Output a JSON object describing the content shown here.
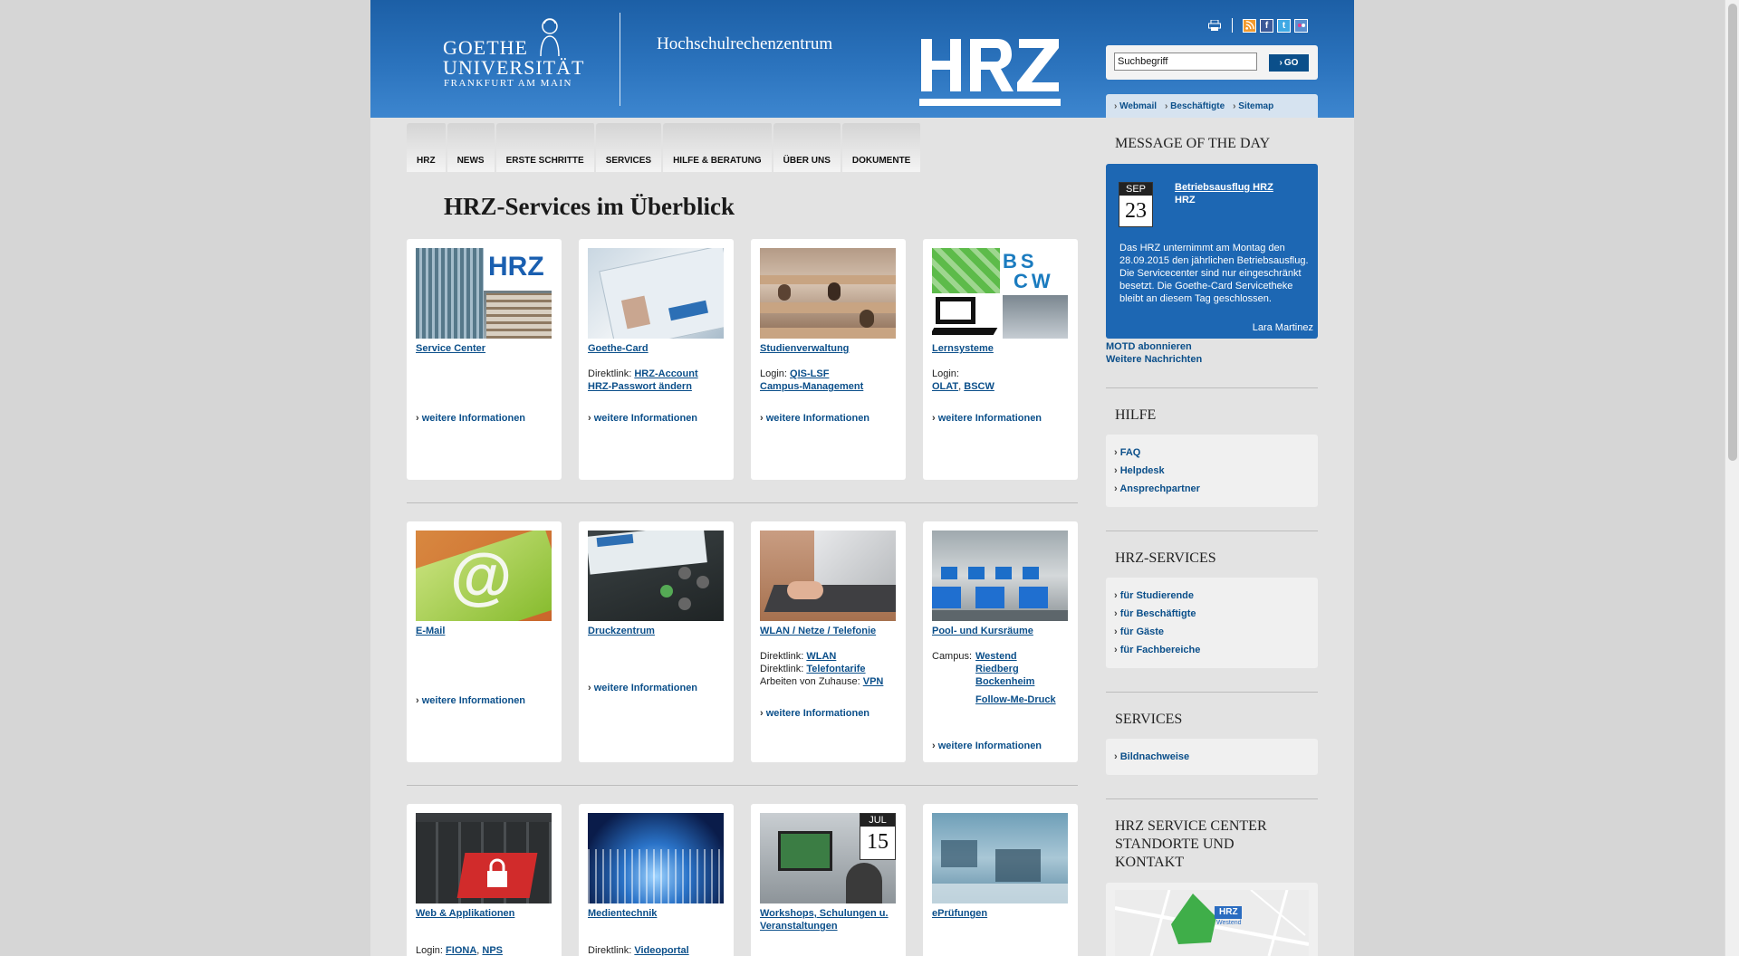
{
  "header": {
    "logo": {
      "line1": "GOETHE",
      "line2": "UNIVERSITÄT",
      "line3": "FRANKFURT AM MAIN"
    },
    "unit_title": "Hochschulrechenzentrum",
    "hrz_logo": "HRZ",
    "icons": [
      "print-icon",
      "rss-icon",
      "facebook-icon",
      "twitter-icon",
      "flickr-icon"
    ],
    "search": {
      "value": "Suchbegriff",
      "go_label": "GO"
    },
    "quicklinks": [
      "Webmail",
      "Beschäftigte",
      "Sitemap"
    ]
  },
  "nav": [
    "HRZ",
    "NEWS",
    "ERSTE SCHRITTE",
    "SERVICES",
    "HILFE & BERATUNG",
    "ÜBER UNS",
    "DOKUMENTE"
  ],
  "page_title": "HRZ-Services im Überblick",
  "cards": {
    "service_center": {
      "title": "Service Center",
      "more": "weitere Informationen",
      "img_text": "HRZ"
    },
    "goethe_card": {
      "title": "Goethe-Card",
      "prefix": "Direktlink:",
      "link1": "HRZ-Account",
      "link2": "HRZ-Passwort ändern",
      "more": "weitere Informationen"
    },
    "studienverwaltung": {
      "title": "Studienverwaltung",
      "prefix": "Login:",
      "link1": "QIS-LSF",
      "link2": "Campus-Management",
      "more": "weitere Informationen"
    },
    "lernsysteme": {
      "title": "Lernsysteme",
      "prefix": "Login:",
      "link1": "OLAT",
      "sep": ",",
      "link2": "BSCW",
      "more": "weitere Informationen"
    },
    "email": {
      "title": "E-Mail",
      "more": "weitere Informationen"
    },
    "druckzentrum": {
      "title": "Druckzentrum",
      "more": "weitere Informationen"
    },
    "wlan": {
      "title": "WLAN / Netze / Telefonie",
      "l1": "Direktlink:",
      "a1": "WLAN",
      "l2": "Direktlink:",
      "a2": "Telefontarife",
      "l3": "Arbeiten von Zuhause:",
      "a3": "VPN",
      "more": "weitere Informationen"
    },
    "pool": {
      "title": "Pool- und Kursräume",
      "prefix": "Campus:",
      "links": [
        "Westend",
        "Riedberg",
        "Bockenheim"
      ],
      "extra": "Follow-Me-Druck",
      "more": "weitere Informationen"
    },
    "web": {
      "title": "Web & Applikationen",
      "prefix": "Login:",
      "link1": "FIONA",
      "link2": "NPS"
    },
    "medientechnik": {
      "title": "Medientechnik",
      "prefix": "Direktlink:",
      "link1": "Videoportal"
    },
    "workshops": {
      "title": "Workshops, Schulungen u. Veranstaltungen",
      "cal_month": "JUL",
      "cal_day": "15"
    },
    "epruefungen": {
      "title": "ePrüfungen"
    }
  },
  "sidebar": {
    "motd_heading": "MESSAGE OF THE DAY",
    "motd": {
      "month": "SEP",
      "day": "23",
      "title": "Betriebsausflug HRZ",
      "subtitle": "HRZ",
      "body": "Das HRZ unternimmt am Montag den 28.09.2015 den jährlichen Betriebsausflug. Die Servicecenter sind nur eingeschränkt besetzt. Die Goethe-Card Servicetheke bleibt an diesem Tag geschlossen.",
      "author": "Lara Martinez"
    },
    "motd_links": [
      "MOTD abonnieren",
      "Weitere Nachrichten"
    ],
    "hilfe": {
      "heading": "HILFE",
      "items": [
        "FAQ",
        "Helpdesk",
        "Ansprechpartner"
      ]
    },
    "hrz_services": {
      "heading": "HRZ-SERVICES",
      "items": [
        "für Studierende",
        "für Beschäftigte",
        "für Gäste",
        "für Fachbereiche"
      ]
    },
    "services": {
      "heading": "SERVICES",
      "items": [
        "Bildnachweise"
      ]
    },
    "service_center": {
      "heading_l1": "HRZ SERVICE CENTER",
      "heading_l2": "STANDORTE UND",
      "heading_l3": "KONTAKT",
      "map_label": "HRZ",
      "map_sub": "Westend"
    }
  },
  "colors": {
    "header_blue": "#1c5fa6",
    "link_blue": "#0b4f8a",
    "motd_blue": "#1d67b3"
  }
}
